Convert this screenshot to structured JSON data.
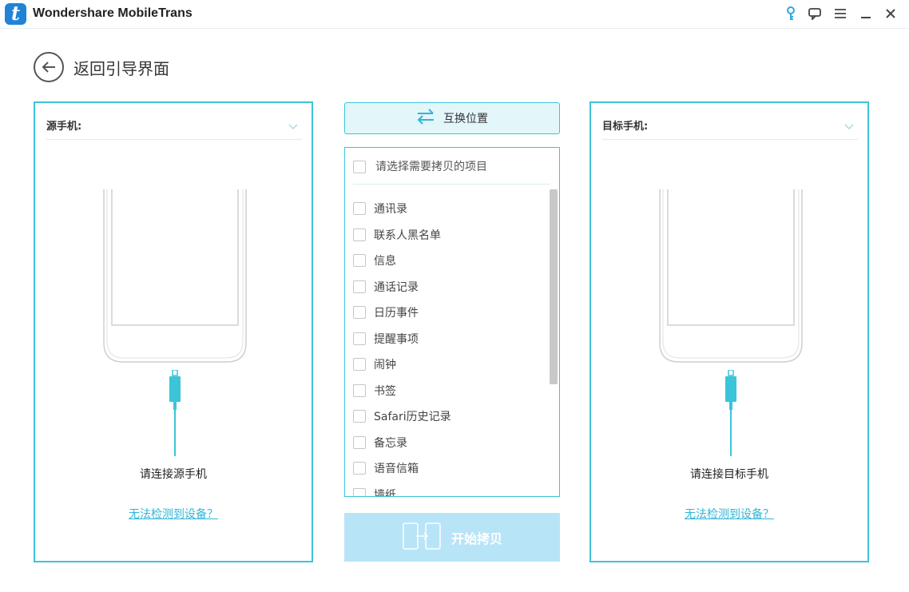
{
  "window": {
    "title": "Wondershare MobileTrans",
    "logo_letter": "t"
  },
  "titlebar_icons": [
    "key-icon",
    "feedback-icon",
    "menu-icon",
    "minimize-icon",
    "close-icon"
  ],
  "back": {
    "label": "返回引导界面"
  },
  "source": {
    "header": "源手机:",
    "connect_text": "请连接源手机",
    "detect_link": "无法检测到设备？"
  },
  "target": {
    "header": "目标手机:",
    "connect_text": "请连接目标手机",
    "detect_link": "无法检测到设备？"
  },
  "swap": {
    "label": "互换位置"
  },
  "list": {
    "header": "请选择需要拷贝的项目",
    "items": [
      "通讯录",
      "联系人黑名单",
      "信息",
      "通话记录",
      "日历事件",
      "提醒事项",
      "闹钟",
      "书签",
      "Safari历史记录",
      "备忘录",
      "语音信箱",
      "墙纸"
    ]
  },
  "start": {
    "label": "开始拷贝"
  },
  "colors": {
    "accent": "#3cc4d9",
    "link": "#2fb6d6",
    "start_disabled": "#b8e4f7",
    "logo": "#1f84d6"
  }
}
